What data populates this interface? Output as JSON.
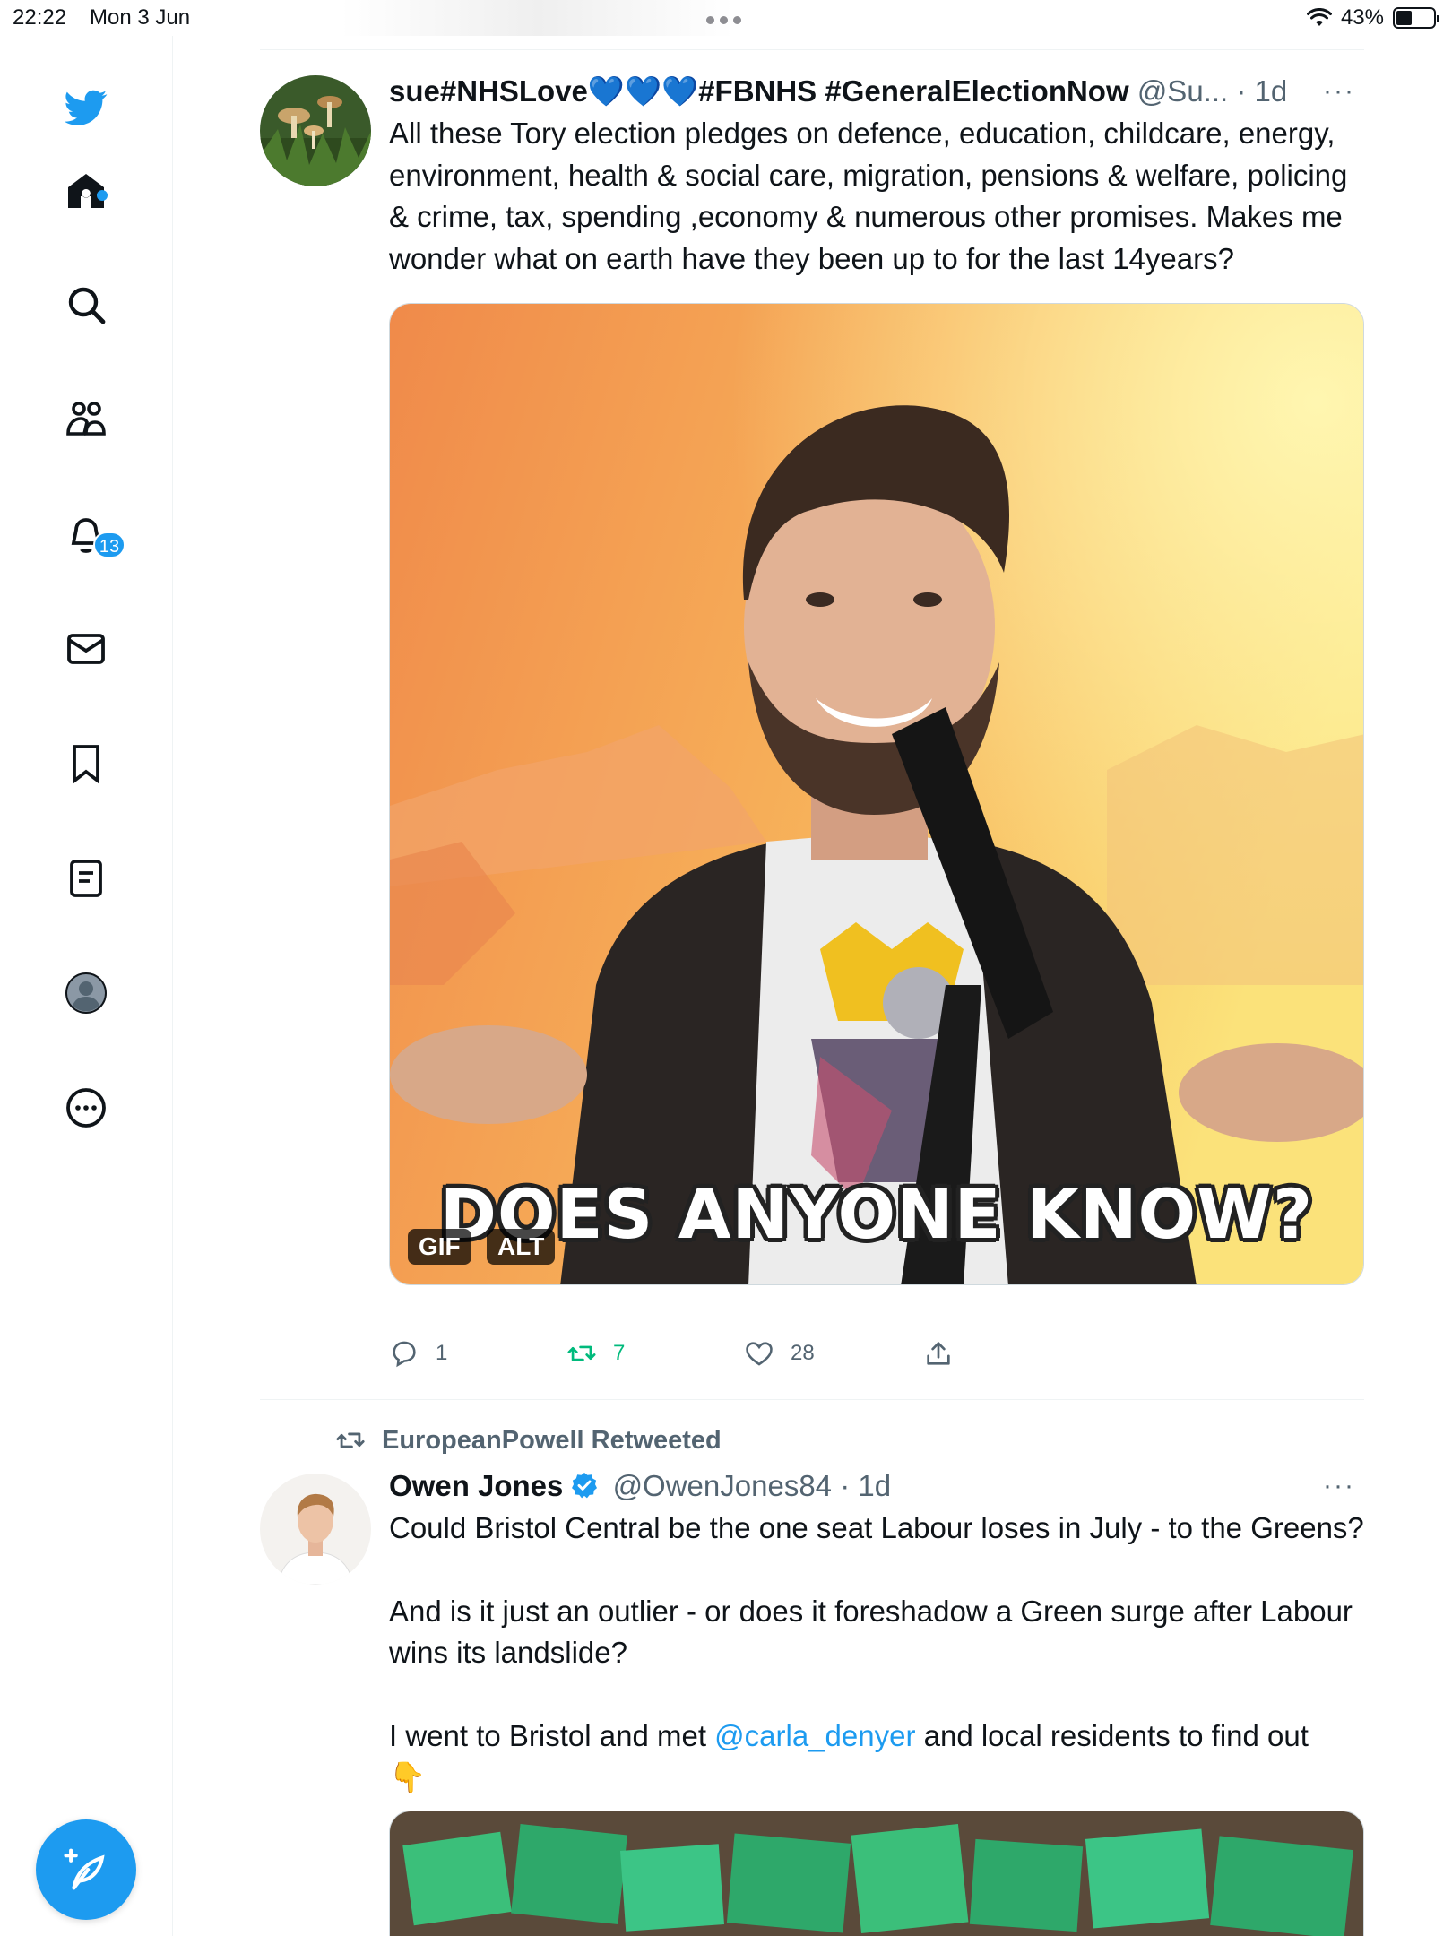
{
  "status_bar": {
    "time": "22:22",
    "date": "Mon 3 Jun",
    "battery_percent": "43%",
    "battery_level": 0.43
  },
  "sidebar": {
    "items": [
      {
        "icon": "twitter-logo-icon"
      },
      {
        "icon": "home-icon"
      },
      {
        "icon": "search-icon"
      },
      {
        "icon": "communities-icon"
      },
      {
        "icon": "notifications-icon",
        "badge": "13"
      },
      {
        "icon": "messages-icon"
      },
      {
        "icon": "bookmarks-icon"
      },
      {
        "icon": "lists-icon"
      },
      {
        "icon": "profile-icon"
      },
      {
        "icon": "more-icon"
      }
    ],
    "compose_icon": "compose-feather-icon"
  },
  "tweets": [
    {
      "name": "sue#NHSLove💙💙💙#FBNHS #GeneralElectionNow",
      "handle": "@Su...",
      "separator": " · ",
      "time": "1d",
      "more": "···",
      "text": "All these Tory election pledges on defence, education, childcare, energy, environment, health & social care, migration, pensions & welfare, policing & crime, tax, spending ,economy & numerous other promises. Makes me wonder what on earth have they been up to for the last 14years?",
      "media": {
        "caption": "DOES ANYONE KNOW?",
        "gif_label": "GIF",
        "alt_label": "ALT"
      },
      "actions": {
        "replies": "1",
        "retweets": "7",
        "likes": "28"
      },
      "colors": {
        "retweeted": "#00ba7c"
      }
    },
    {
      "retweeted_by": "EuropeanPowell Retweeted",
      "name": "Owen Jones",
      "handle": "@OwenJones84",
      "separator": " · ",
      "time": "1d",
      "more": "···",
      "text_p1": "Could Bristol Central be the one seat Labour loses in July - to the Greens?",
      "text_p2": "And is it just an outlier - or does it foreshadow a Green surge after Labour wins its landslide?",
      "text_p3_before": "I went to Bristol and met ",
      "mention": "@carla_denyer",
      "text_p3_after": " and local residents to find out",
      "emoji": "👇"
    }
  ],
  "colors": {
    "accent": "#1d9bf0",
    "text": "#0f1419",
    "secondary": "#536471"
  }
}
